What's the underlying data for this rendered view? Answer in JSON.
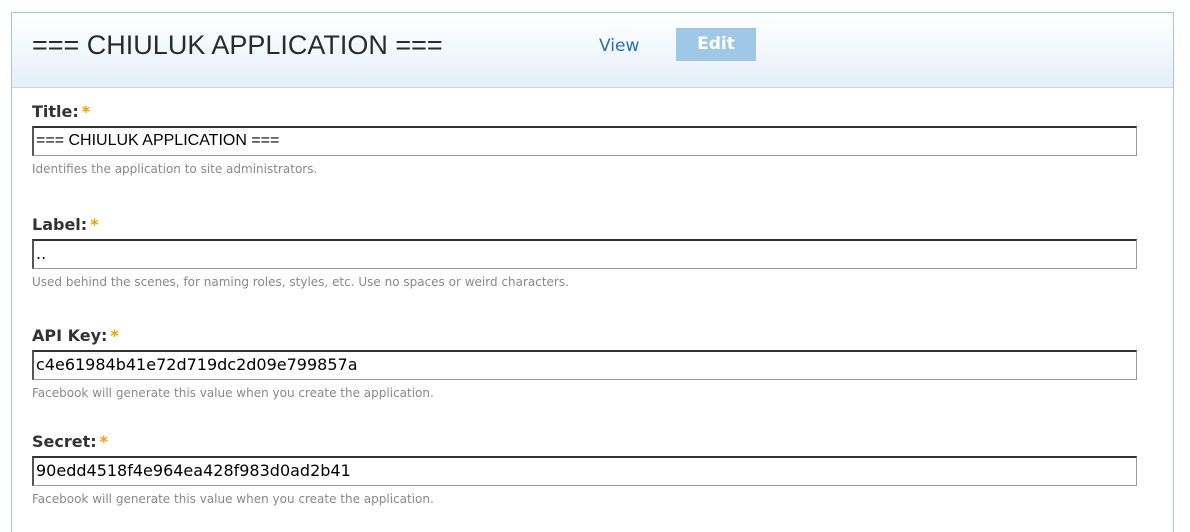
{
  "header": {
    "title": "=== CHIULUK APPLICATION ===",
    "tabs": [
      {
        "label": "View",
        "active": false
      },
      {
        "label": "Edit",
        "active": true
      }
    ]
  },
  "form": {
    "required_marker": "*",
    "fields": [
      {
        "label": "Title:",
        "value": "=== CHIULUK APPLICATION ===",
        "description": "Identifies the application to site administrators."
      },
      {
        "label": "Label:",
        "value": "..",
        "description": "Used behind the scenes, for naming roles, styles, etc. Use no spaces or weird characters."
      },
      {
        "label": "API Key:",
        "value": "c4e61984b41e72d719dc2d09e799857a",
        "description": "Facebook will generate this value when you create the application."
      },
      {
        "label": "Secret:",
        "value": "90edd4518f4e964ea428f983d0ad2b41",
        "description": "Facebook will generate this value when you create the application."
      }
    ]
  },
  "colors": {
    "link": "#2470b6",
    "active_tab_bg": "#9fc7e6",
    "required_star": "#f2a000",
    "description_text": "#898989"
  }
}
